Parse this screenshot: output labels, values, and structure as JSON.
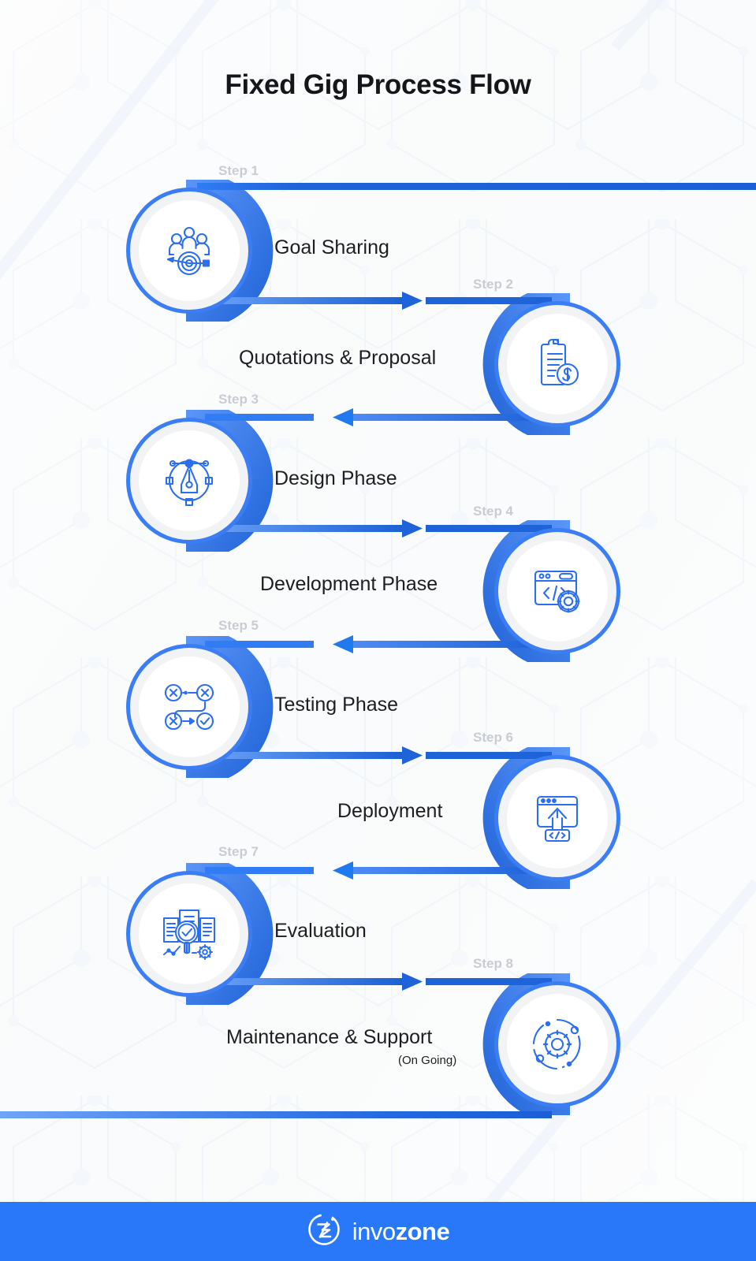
{
  "page": {
    "title": "Fixed Gig Process Flow",
    "background_color": "#f8fafb",
    "accent_color": "#2878f9",
    "accent_dark": "#1a5fd6",
    "accent_light": "#5b95f7",
    "step_label_color": "#c9ccd2",
    "label_color": "#1d1e22"
  },
  "steps": [
    {
      "step_label": "Step 1",
      "name": "Goal Sharing",
      "sublabel": "",
      "icon": "team-target-icon",
      "side": "left"
    },
    {
      "step_label": "Step 2",
      "name": "Quotations & Proposal",
      "sublabel": "",
      "icon": "clipboard-dollar-icon",
      "side": "right"
    },
    {
      "step_label": "Step 3",
      "name": "Design Phase",
      "sublabel": "",
      "icon": "pen-tool-icon",
      "side": "left"
    },
    {
      "step_label": "Step 4",
      "name": "Development Phase",
      "sublabel": "",
      "icon": "code-window-gear-icon",
      "side": "right"
    },
    {
      "step_label": "Step 5",
      "name": "Testing Phase",
      "sublabel": "",
      "icon": "test-flow-check-icon",
      "side": "left"
    },
    {
      "step_label": "Step 6",
      "name": "Deployment",
      "sublabel": "",
      "icon": "deploy-upload-icon",
      "side": "right"
    },
    {
      "step_label": "Step 7",
      "name": "Evaluation",
      "sublabel": "",
      "icon": "evaluation-magnifier-icon",
      "side": "left"
    },
    {
      "step_label": "Step 8",
      "name": "Maintenance & Support",
      "sublabel": "(On Going)",
      "icon": "gear-orbit-icon",
      "side": "right"
    }
  ],
  "footer": {
    "brand_light": "invo",
    "brand_bold": "zone",
    "logo_icon": "invozone-logo-icon",
    "background_color": "#2878f9"
  }
}
